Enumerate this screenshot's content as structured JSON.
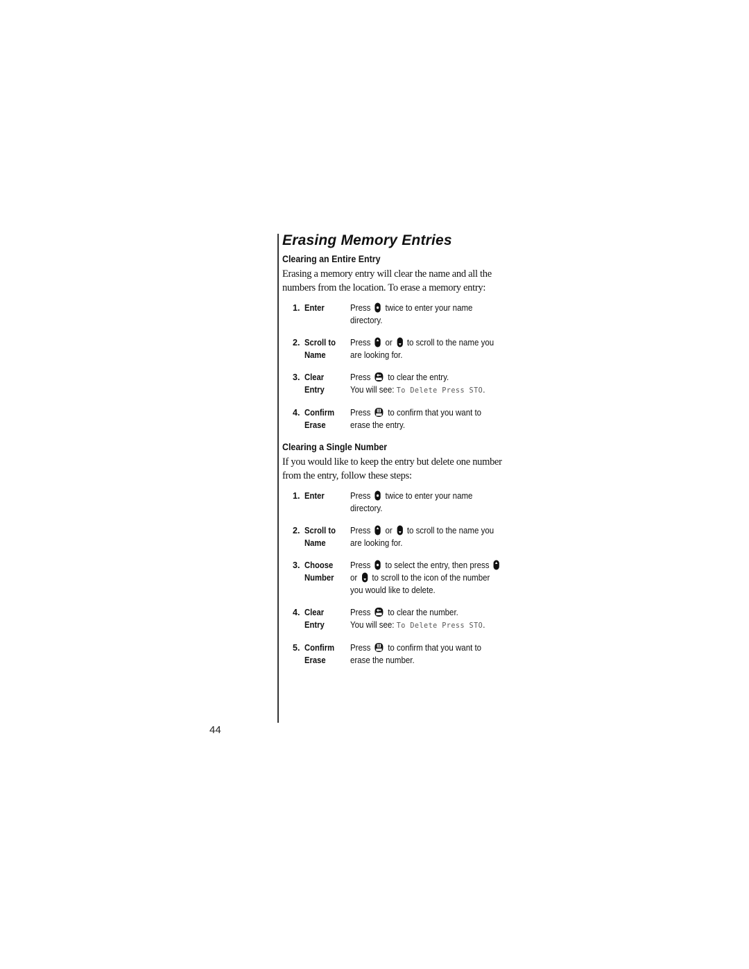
{
  "page": {
    "title": "Erasing Memory Entries",
    "page_number": "44"
  },
  "section1": {
    "heading": "Clearing an Entire Entry",
    "intro": "Erasing a memory entry will clear the name and all the numbers from the location. To erase a memory entry:",
    "steps": [
      {
        "num": "1.",
        "label": "Enter",
        "parts": [
          "Press ",
          "{menu}",
          " twice to enter your name directory."
        ]
      },
      {
        "num": "2.",
        "label": "Scroll to\nName",
        "parts": [
          "Press ",
          "{up}",
          " or ",
          "{down}",
          " to scroll to the name you are looking for."
        ]
      },
      {
        "num": "3.",
        "label": "Clear\nEntry",
        "parts": [
          "Press ",
          "{clr}",
          " to clear the entry.",
          "{br}",
          "You will see: ",
          "{lcd:To Delete Press STO}",
          "."
        ]
      },
      {
        "num": "4.",
        "label": "Confirm\nErase",
        "parts": [
          "Press ",
          "{sto}",
          " to confirm that you want to erase the entry."
        ]
      }
    ]
  },
  "section2": {
    "heading": "Clearing a Single Number",
    "intro": "If you would like to keep the entry but delete one number from the entry, follow these steps:",
    "steps": [
      {
        "num": "1.",
        "label": "Enter",
        "parts": [
          "Press ",
          "{menu}",
          " twice to enter your name directory."
        ]
      },
      {
        "num": "2.",
        "label": "Scroll to\nName",
        "parts": [
          "Press ",
          "{up}",
          " or ",
          "{down}",
          " to scroll to the name you are looking for."
        ]
      },
      {
        "num": "3.",
        "label": "Choose\nNumber",
        "parts": [
          "Press ",
          "{menu}",
          " to select the entry, then press ",
          "{up}",
          " or ",
          "{down}",
          " to scroll to the icon of the number you would like to delete."
        ]
      },
      {
        "num": "4.",
        "label": "Clear\nEntry",
        "parts": [
          "Press ",
          "{clr}",
          " to clear the number.",
          "{br}",
          "You will see: ",
          "{lcd:To Delete Press STO}",
          "."
        ]
      },
      {
        "num": "5.",
        "label": "Confirm\nErase",
        "parts": [
          "Press ",
          "{sto}",
          " to confirm that you want to erase the number."
        ]
      }
    ]
  },
  "icons": {
    "menu": "menu-key-icon",
    "up": "scroll-up-key-icon",
    "down": "scroll-down-key-icon",
    "clr": "clear-key-icon",
    "sto": "store-key-icon"
  }
}
